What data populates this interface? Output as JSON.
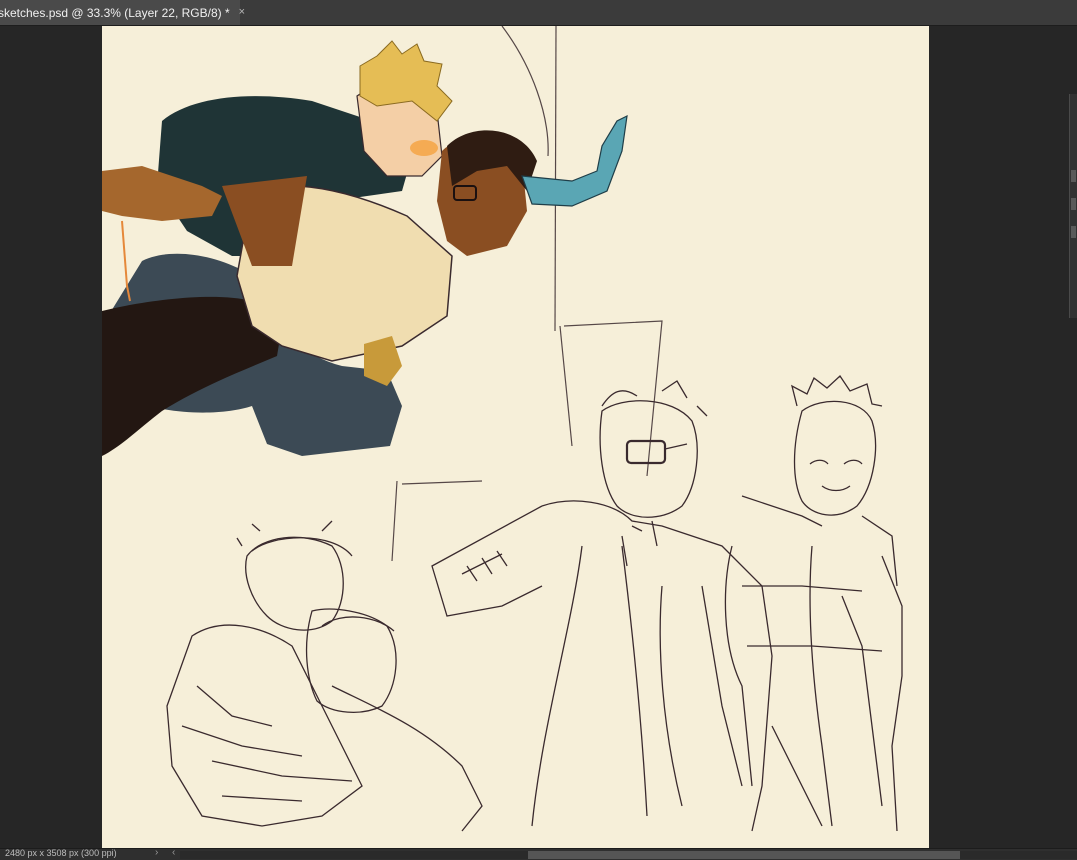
{
  "document_tab": {
    "title": "sketches.psd @ 33.3% (Layer 22, RGB/8) *",
    "close_glyph": "×"
  },
  "status_bar": {
    "doc_info": "2480 px x 3508 px (300 ppi)",
    "arrow_glyph": "›",
    "arrow_left_glyph": "‹"
  },
  "canvas": {
    "background": "#f6efd9",
    "content": "illustration-artwork"
  },
  "colors": {
    "workspace": "#262626",
    "tabbar": "#3b3b3b",
    "tab_active": "#4a4a4a",
    "sketch_line": "#3a2a2e",
    "jacket_dark": "#1f3436",
    "hair_blond": "#e5bd55",
    "skin_brown": "#8a4e22",
    "arm_blue": "#5aa6b4",
    "pants_blue": "#3c4a55",
    "pants_black": "#231712",
    "shirt_cream": "#f0ddb0"
  }
}
